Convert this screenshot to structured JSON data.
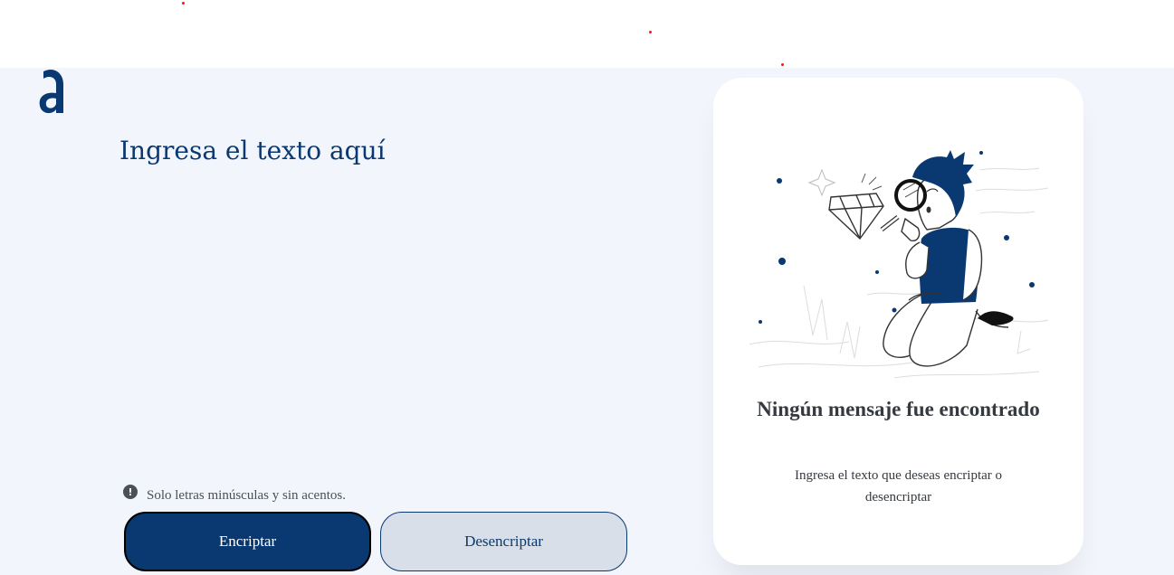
{
  "header": {
    "logo_letter": "a"
  },
  "input": {
    "placeholder": "Ingresa el texto aquí",
    "value": ""
  },
  "warning": {
    "icon": "exclamation-circle-icon",
    "text": "Solo letras minúsculas y sin acentos."
  },
  "buttons": {
    "encrypt_label": "Encriptar",
    "decrypt_label": "Desencriptar"
  },
  "result_panel": {
    "illustration": "person-with-magnifying-glass-and-diamond",
    "title": "Ningún mensaje fue encontrado",
    "message": "Ingresa el texto que deseas encriptar o desencriptar"
  },
  "colors": {
    "primary": "#0a3871",
    "background": "#f2f5fc",
    "secondary_button": "#d8dfe8",
    "text_dark": "#343a40",
    "text_gray": "#495057"
  }
}
